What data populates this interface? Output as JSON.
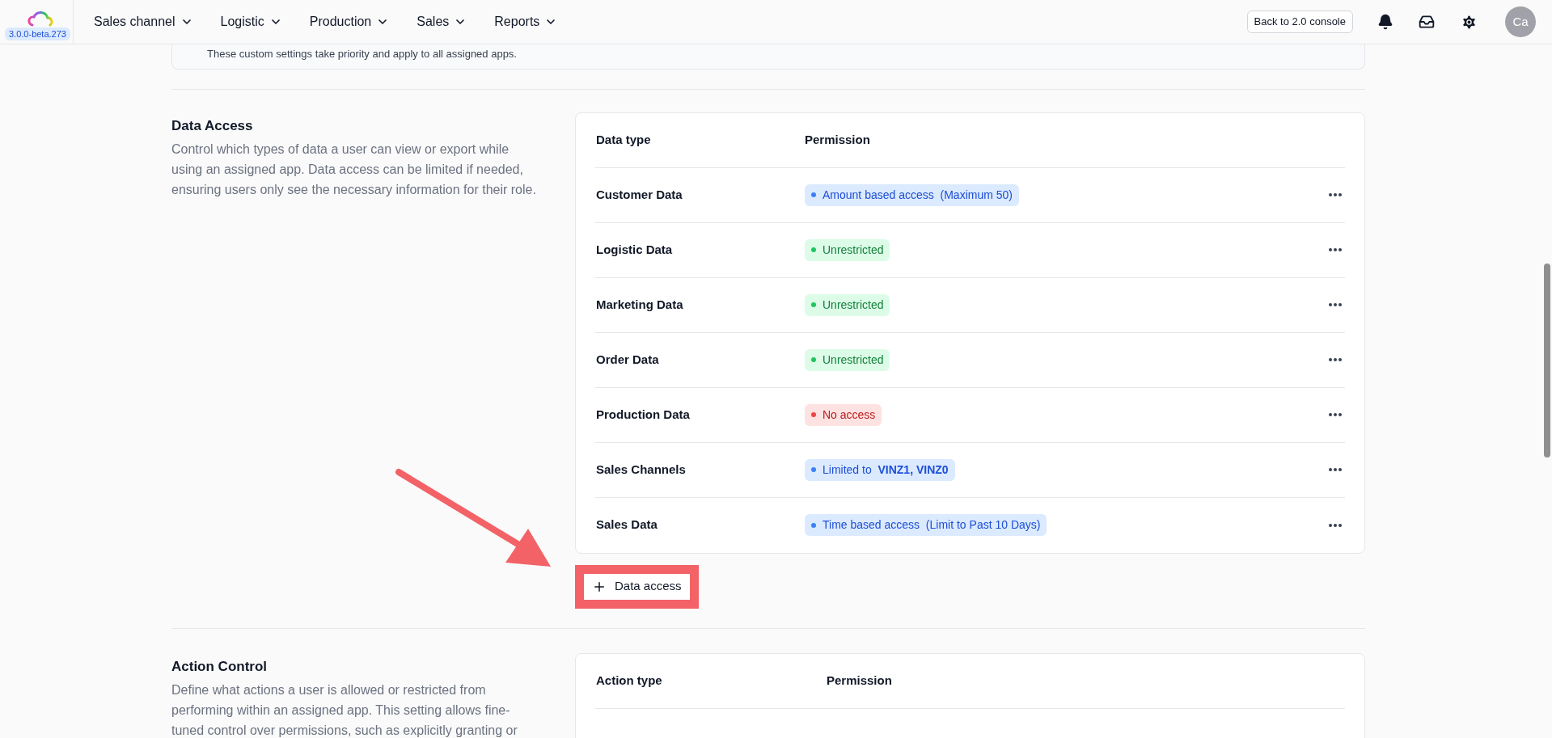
{
  "app": {
    "version": "3.0.0-beta.273"
  },
  "nav": [
    {
      "label": "Sales channel"
    },
    {
      "label": "Logistic"
    },
    {
      "label": "Production"
    },
    {
      "label": "Sales"
    },
    {
      "label": "Reports"
    }
  ],
  "header_actions": {
    "console_button": "Back to 2.0 console",
    "avatar": "Ca"
  },
  "notice": {
    "text": "These custom settings take priority and apply to all assigned apps."
  },
  "data_access": {
    "title": "Data Access",
    "description": "Control which types of data a user can view or export while using an assigned app. Data access can be limited if needed, ensuring users only see the necessary information for their role.",
    "columns": [
      "Data type",
      "Permission"
    ],
    "rows": [
      {
        "type": "Customer Data",
        "permission": "Amount based access  (Maximum 50)",
        "kind": "limited"
      },
      {
        "type": "Logistic Data",
        "permission": "Unrestricted",
        "kind": "unrestricted"
      },
      {
        "type": "Marketing Data",
        "permission": "Unrestricted",
        "kind": "unrestricted"
      },
      {
        "type": "Order Data",
        "permission": "Unrestricted",
        "kind": "unrestricted"
      },
      {
        "type": "Production Data",
        "permission": "No access",
        "kind": "denied"
      },
      {
        "type": "Sales Channels",
        "permission": "Limited to  **VINZ1, VINZ0**",
        "kind": "limited"
      },
      {
        "type": "Sales Data",
        "permission": "Time based access  (Limit to Past 10 Days)",
        "kind": "limited"
      }
    ],
    "add_button": "Data access"
  },
  "action_control": {
    "title": "Action Control",
    "description": "Define what actions a user is allowed or restricted from performing within an assigned app. This setting allows fine-tuned control over permissions, such as explicitly granting or",
    "columns": [
      "Action type",
      "Permission"
    ]
  }
}
